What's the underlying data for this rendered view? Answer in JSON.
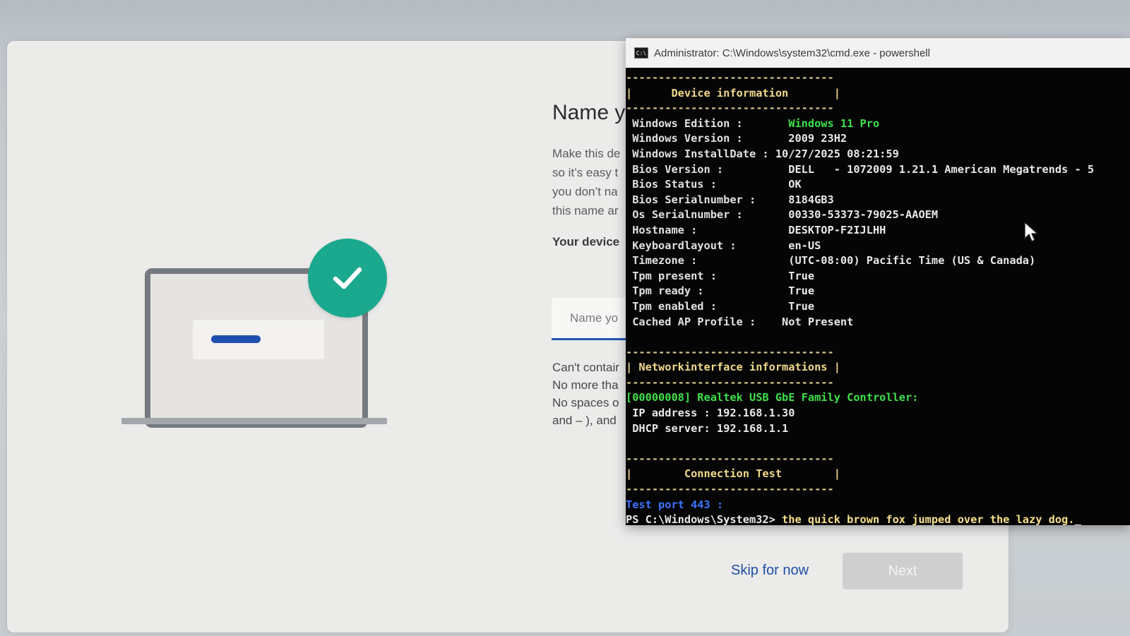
{
  "oobe": {
    "title": "Name y",
    "description_lines": [
      "Make this de",
      "so it’s easy t",
      "you don’t na",
      "this name ar"
    ],
    "device_label": "Your device",
    "input_placeholder": "Name yo",
    "rules_lines": [
      "Can't contair",
      "No more tha",
      "No spaces o",
      "and – ), and"
    ],
    "skip_label": "Skip for now",
    "next_label": "Next",
    "accent_color": "#1f56b4",
    "check_color": "#1aa88e"
  },
  "console": {
    "title": "Administrator: C:\\Windows\\system32\\cmd.exe - powershell",
    "icon_text": "C:\\",
    "dash_line": "--------------------------------",
    "device_section": "|      Device information       |",
    "device_rows": [
      {
        "key": " Windows Edition :       ",
        "value": "Windows 11 Pro",
        "highlight": true
      },
      {
        "key": " Windows Version :       ",
        "value": "2009 23H2"
      },
      {
        "key": " Windows InstallDate : ",
        "value": "10/27/2025 08:21:59"
      },
      {
        "key": " Bios Version :          ",
        "value": "DELL   - 1072009 1.21.1 American Megatrends - 5"
      },
      {
        "key": " Bios Status :           ",
        "value": "OK"
      },
      {
        "key": " Bios Serialnumber :     ",
        "value": "8184GB3"
      },
      {
        "key": " Os Serialnumber :       ",
        "value": "00330-53373-79025-AAOEM"
      },
      {
        "key": " Hostname :              ",
        "value": "DESKTOP-F2IJLHH"
      },
      {
        "key": " Keyboardlayout :        ",
        "value": "en-US"
      },
      {
        "key": " Timezone :              ",
        "value": "(UTC-08:00) Pacific Time (US & Canada)"
      },
      {
        "key": " Tpm present :           ",
        "value": "True"
      },
      {
        "key": " Tpm ready :             ",
        "value": "True"
      },
      {
        "key": " Tpm enabled :           ",
        "value": "True"
      },
      {
        "key": " Cached AP Profile :    ",
        "value": "Not Present"
      }
    ],
    "network_section": "| Networkinterface informations |",
    "adapter_line": "[00000008] Realtek USB GbE Family Controller:",
    "ip_line": " IP address : 192.168.1.30",
    "dhcp_line": " DHCP server: 192.168.1.1",
    "connection_section": "|        Connection Test        |",
    "test_port_line": "Test port 443 :",
    "prompt": "PS C:\\Windows\\System32> ",
    "command": "the quick brown fox jumped over the lazy dog.",
    "cursor": "_"
  }
}
